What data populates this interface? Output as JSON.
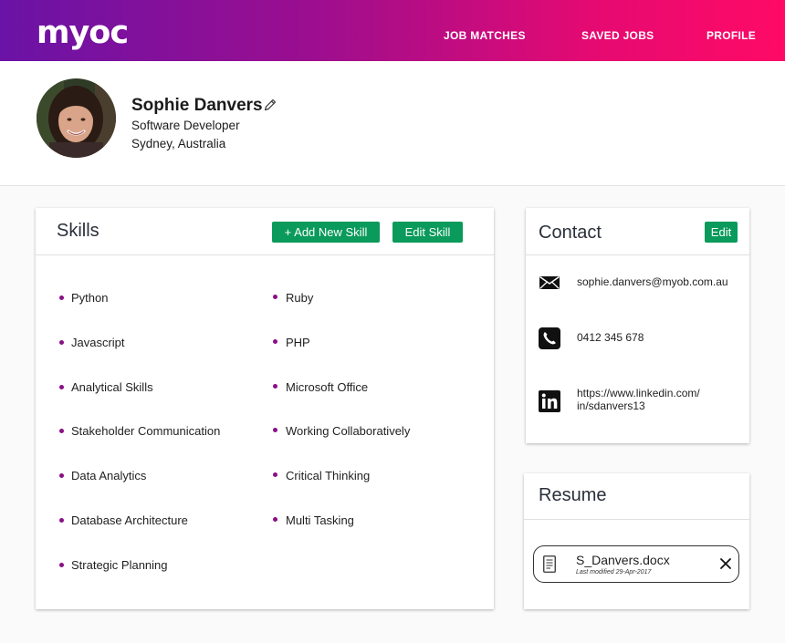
{
  "brand": {
    "logo": "myoc"
  },
  "nav": {
    "job_matches": "JOB MATCHES",
    "saved_jobs": "SAVED JOBS",
    "profile": "PROFILE"
  },
  "profile": {
    "name": "Sophie Danvers",
    "title": "Software Developer",
    "location": "Sydney, Australia"
  },
  "skills": {
    "title": "Skills",
    "add_button": "+ Add New Skill",
    "edit_button": "Edit Skill",
    "left": [
      "Python",
      "Javascript",
      "Analytical Skills",
      "Stakeholder Communication",
      "Data Analytics",
      "Database Architecture",
      "Strategic Planning"
    ],
    "right": [
      "Ruby",
      "PHP",
      "Microsoft Office",
      "Working Collaboratively",
      "Critical Thinking",
      "Multi Tasking"
    ]
  },
  "contact": {
    "title": "Contact",
    "edit_button": "Edit",
    "email": "sophie.danvers@myob.com.au",
    "phone": "0412 345 678",
    "linkedin_line1": "https://www.linkedin.com/",
    "linkedin_line2": "in/sdanvers13"
  },
  "resume": {
    "title": "Resume",
    "file_name": "S_Danvers.docx",
    "modified": "Last modified 29-Apr-2017"
  },
  "colors": {
    "accent_green": "#0a9a5b",
    "bullet": "#8a0f86",
    "gradient_start": "#6a13a6",
    "gradient_end": "#ff0a66"
  }
}
